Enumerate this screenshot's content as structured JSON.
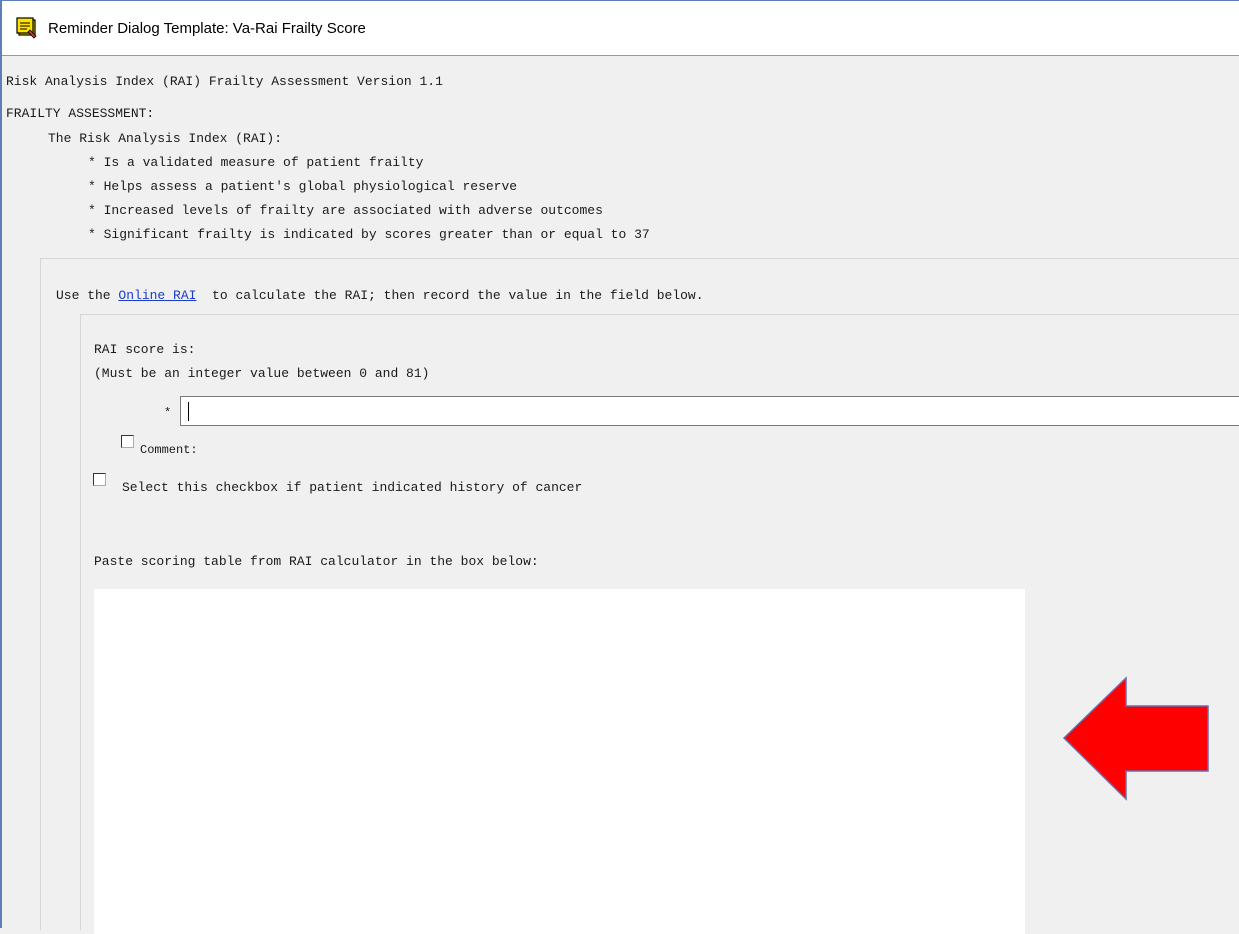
{
  "window": {
    "title": "Reminder Dialog Template: Va-Rai Frailty Score",
    "title_icon": "reminder-dialog-icon"
  },
  "header": {
    "version_line": "Risk Analysis Index (RAI) Frailty Assessment Version 1.1",
    "section_heading": "FRAILTY ASSESSMENT:",
    "intro": "The Risk Analysis Index (RAI):",
    "bullets": [
      "* Is a validated measure of patient frailty",
      "* Helps assess a patient's global physiological reserve",
      "* Increased levels of frailty are associated with adverse outcomes",
      "* Significant frailty is indicated by scores greater than or equal to 37"
    ]
  },
  "instructions": {
    "prefix": "Use the ",
    "link_text": "Online RAI",
    "suffix": "  to calculate the RAI; then record the value in the field below."
  },
  "score": {
    "label": "RAI score is:",
    "hint": "(Must be an integer value between 0 and 81)",
    "required_marker": "*",
    "value": ""
  },
  "comment": {
    "label": "Comment:",
    "checked": false
  },
  "cancer": {
    "label": "Select this checkbox if patient indicated history of cancer",
    "checked": false
  },
  "paste": {
    "label": "Paste scoring table from RAI calculator in the box below:",
    "value": ""
  },
  "annotation": {
    "arrow_color": "#ff0000",
    "arrow_direction": "left"
  }
}
